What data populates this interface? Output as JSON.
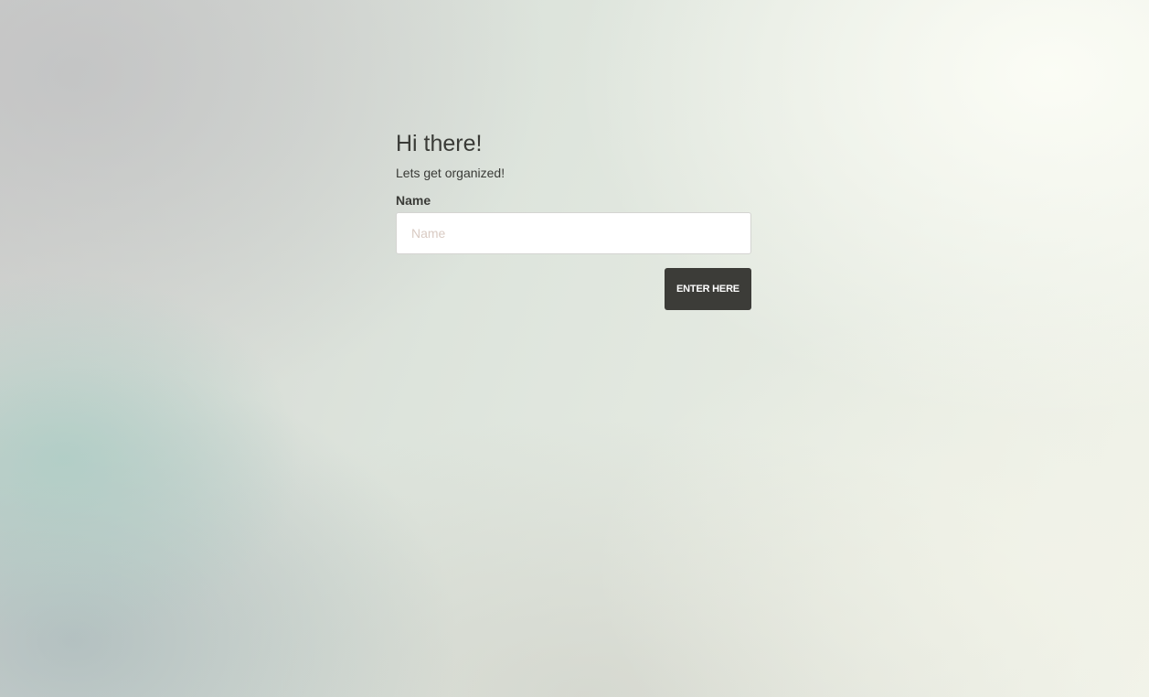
{
  "form": {
    "greeting": "Hi there!",
    "subtitle": "Lets get organized!",
    "name_label": "Name",
    "name_placeholder": "Name",
    "name_value": "",
    "submit_label": "ENTER HERE"
  }
}
